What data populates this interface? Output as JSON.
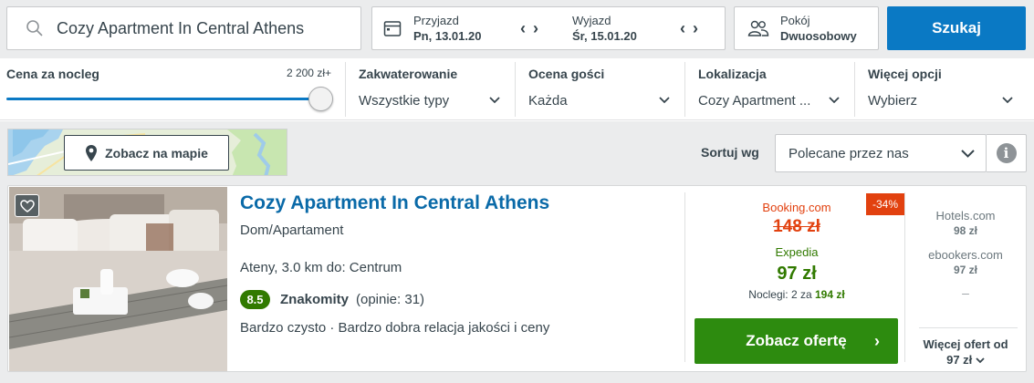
{
  "search": {
    "query": "Cozy Apartment In Central Athens",
    "checkin_label": "Przyjazd",
    "checkin_value": "Pn, 13.01.20",
    "checkout_label": "Wyjazd",
    "checkout_value": "Śr, 15.01.20",
    "room_label": "Pokój",
    "room_value": "Dwuosobowy",
    "button_label": "Szukaj"
  },
  "filters": {
    "price_title": "Cena za nocleg",
    "price_max": "2 200 zł+",
    "price_level": 1.0,
    "groups": [
      {
        "title": "Zakwaterowanie",
        "value": "Wszystkie typy"
      },
      {
        "title": "Ocena gości",
        "value": "Każda"
      },
      {
        "title": "Lokalizacja",
        "value": "Cozy Apartment ..."
      },
      {
        "title": "Więcej opcji",
        "value": "Wybierz"
      }
    ]
  },
  "toolbar": {
    "map_button": "Zobacz na mapie",
    "sort_label": "Sortuj wg",
    "sort_value": "Polecane przez nas",
    "info_glyph": "i"
  },
  "result": {
    "name": "Cozy Apartment In Central Athens",
    "type": "Dom/Apartament",
    "location": "Ateny, 3.0 km do: Centrum",
    "rating_score": "8.5",
    "rating_text": "Znakomity",
    "rating_count": "(opinie: 31)",
    "features": "Bardzo czysto · Bardzo dobra relacja jakości i ceny",
    "deal_tag": "-34%",
    "provider_old": "Booking.com",
    "price_old": "148 zł",
    "provider_best": "Expedia",
    "price_best": "97 zł",
    "nights_text": "Noclegi: 2 za",
    "nights_total": "194 zł",
    "offer_button": "Zobacz ofertę",
    "alternatives": [
      {
        "name": "Hotels.com",
        "price": "98 zł"
      },
      {
        "name": "ebookers.com",
        "price": "97 zł"
      }
    ],
    "alt_dash": "–",
    "more_offers_label": "Więcej ofert od",
    "more_offers_price": "97 zł"
  },
  "colors": {
    "accent_blue": "#0a79c4",
    "title_blue": "#0a6aa8",
    "offer_green": "#2d8b0f",
    "price_green": "#317a00",
    "deal_red": "#e2410f"
  }
}
